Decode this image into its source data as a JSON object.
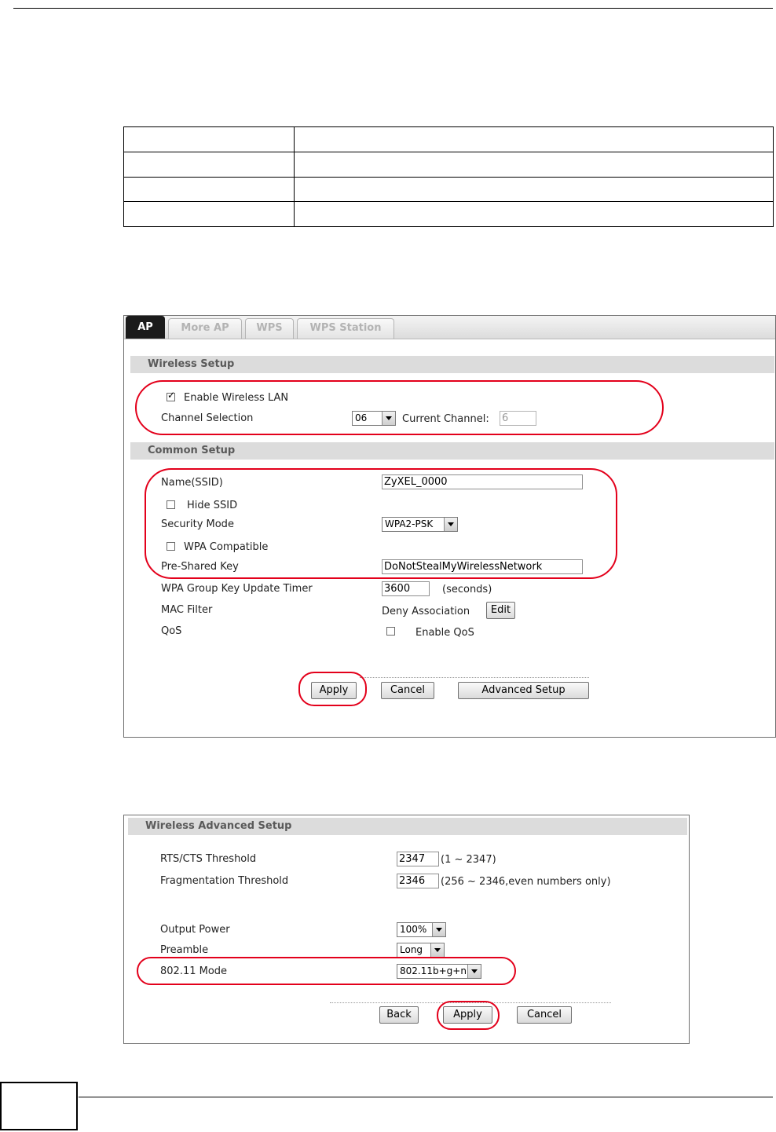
{
  "ap_panel": {
    "tabs": [
      "AP",
      "More AP",
      "WPS",
      "WPS Station"
    ],
    "wireless_setup": {
      "title": "Wireless Setup",
      "enable_wireless_lan": "Enable Wireless LAN",
      "enable_checked": true,
      "channel_selection_label": "Channel Selection",
      "channel_value": "06",
      "current_channel_label": "Current Channel:",
      "current_channel_value": "6"
    },
    "common_setup": {
      "title": "Common Setup",
      "ssid_label": "Name(SSID)",
      "ssid_value": "ZyXEL_0000",
      "hide_ssid": "Hide SSID",
      "security_mode_label": "Security Mode",
      "security_mode_value": "WPA2-PSK",
      "wpa_compatible": "WPA Compatible",
      "psk_label": "Pre-Shared Key",
      "psk_value": "DoNotStealMyWirelessNetwork",
      "group_key_label": "WPA Group Key Update Timer",
      "group_key_value": "3600",
      "group_key_unit": "(seconds)",
      "mac_filter_label": "MAC Filter",
      "mac_filter_value": "Deny Association",
      "mac_filter_edit": "Edit",
      "qos_label": "QoS",
      "enable_qos": "Enable QoS"
    },
    "buttons": {
      "apply": "Apply",
      "cancel": "Cancel",
      "advanced": "Advanced Setup"
    }
  },
  "advanced_panel": {
    "title": "Wireless Advanced Setup",
    "rts_label": "RTS/CTS  Threshold",
    "rts_value": "2347",
    "rts_range": "(1 ~ 2347)",
    "frag_label": "Fragmentation  Threshold",
    "frag_value": "2346",
    "frag_range": "(256 ~ 2346,even numbers only)",
    "output_power_label": "Output Power",
    "output_power_value": "100%",
    "preamble_label": "Preamble",
    "preamble_value": "Long",
    "mode_label": "802.11 Mode",
    "mode_value": "802.11b+g+n",
    "buttons": {
      "back": "Back",
      "apply": "Apply",
      "cancel": "Cancel"
    }
  },
  "highlight_color": "#e3001b"
}
